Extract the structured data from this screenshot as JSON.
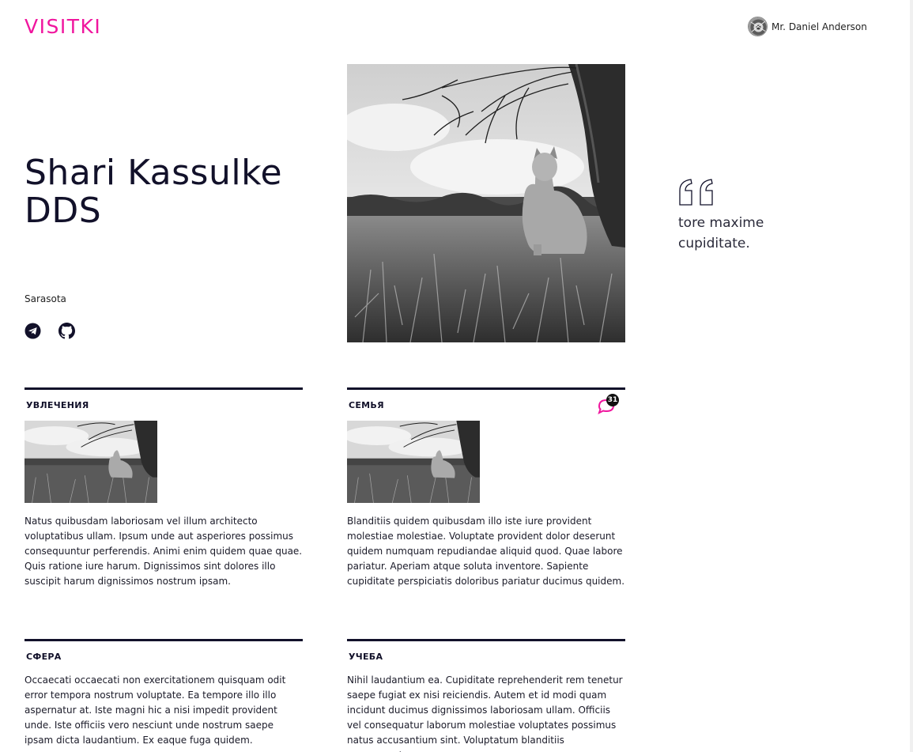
{
  "header": {
    "logo": "VISITKI",
    "user_name": "Mr. Daniel Anderson",
    "avatar_icon": "avatar-image"
  },
  "profile": {
    "name": "Shari Kassulke DDS",
    "city": "Sarasota",
    "socials": [
      {
        "icon": "telegram-icon"
      },
      {
        "icon": "github-icon"
      }
    ],
    "photo": "cat-sitting-in-field-photo"
  },
  "quote": {
    "icon": "quote-icon",
    "text": "tore maxime cupiditate."
  },
  "cards": [
    {
      "title": "УВЛЕЧЕНИЯ",
      "has_photo": true,
      "text": "Natus quibusdam laboriosam vel illum architecto voluptatibus ullam. Ipsum unde aut asperiores possimus consequuntur perferendis. Animi enim quidem quae quae. Quis ratione iure harum. Dignissimos sint dolores illo suscipit harum dignissimos nostrum ipsam."
    },
    {
      "title": "СЕМЬЯ",
      "has_photo": true,
      "comment_count": "31",
      "text": "Blanditiis quidem quibusdam illo iste iure provident molestiae molestiae. Voluptate provident dolor deserunt quidem numquam repudiandae aliquid quod. Quae labore pariatur. Aperiam atque soluta inventore. Sapiente cupiditate perspiciatis doloribus pariatur ducimus quidem."
    },
    {
      "title": "СФЕРА",
      "has_photo": false,
      "text": "Occaecati occaecati non exercitationem quisquam odit error tempora nostrum voluptate. Ea tempore illo illo aspernatur at. Iste magni hic a nisi impedit provident unde. Iste officiis vero nesciunt unde nostrum saepe ipsam dicta laudantium. Ex eaque fuga quidem."
    },
    {
      "title": "УЧЕБА",
      "has_photo": false,
      "text": "Nihil laudantium ea. Cupiditate reprehenderit rem tenetur saepe fugiat ex nisi reiciendis. Autem et id modi quam incidunt ducimus dignissimos laboriosam ullam. Officiis vel consequatur laborum molestiae voluptates possimus natus accusantium sint. Voluptatum blanditiis consequuntur."
    }
  ],
  "colors": {
    "accent": "#f0169e",
    "text": "#12112a"
  }
}
